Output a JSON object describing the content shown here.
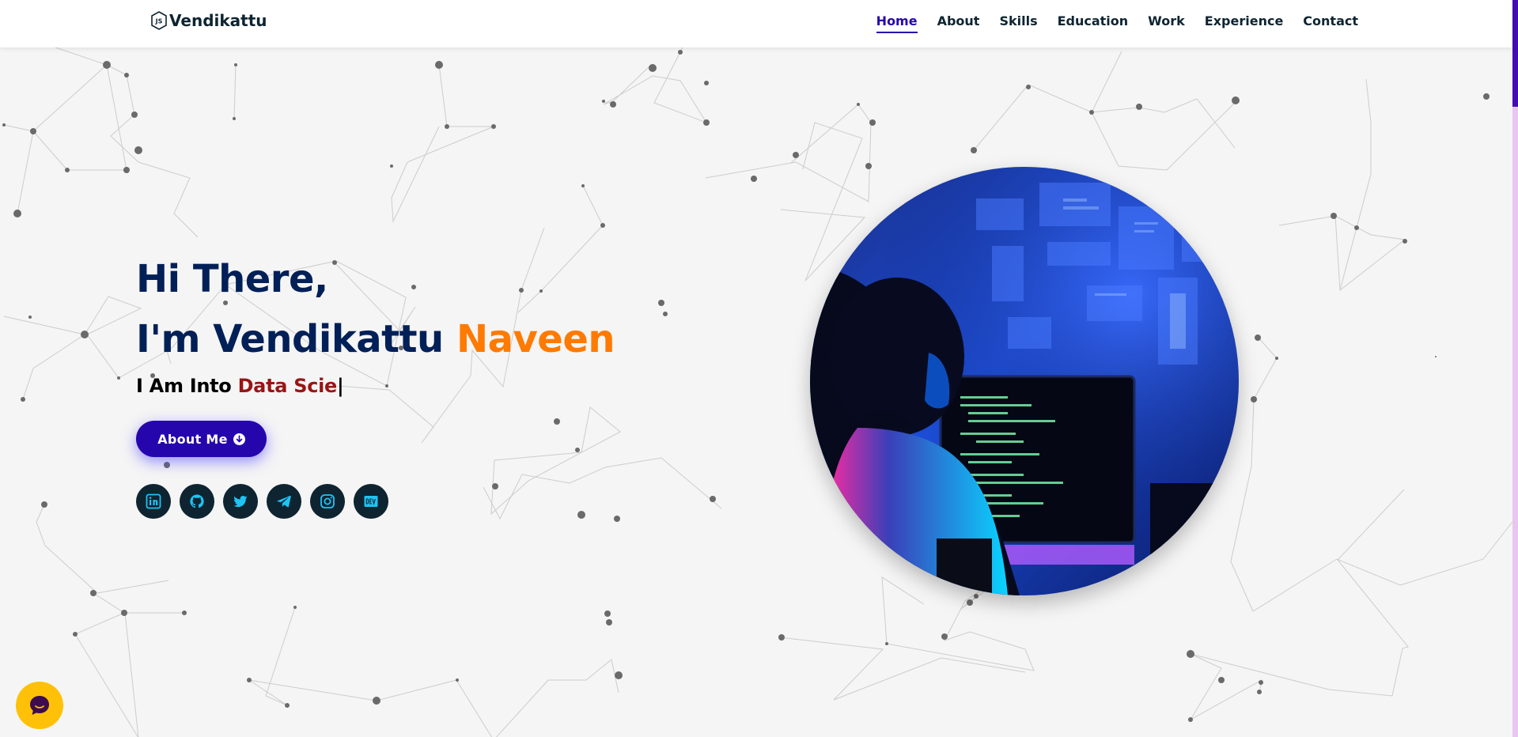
{
  "header": {
    "logo_text": "Vendikattu",
    "logo_icon": "javascript-hex-icon",
    "nav": [
      {
        "label": "Home",
        "active": true
      },
      {
        "label": "About",
        "active": false
      },
      {
        "label": "Skills",
        "active": false
      },
      {
        "label": "Education",
        "active": false
      },
      {
        "label": "Work",
        "active": false
      },
      {
        "label": "Experience",
        "active": false
      },
      {
        "label": "Contact",
        "active": false
      }
    ]
  },
  "hero": {
    "greeting": "Hi There,",
    "intro": "I'm Vendikattu ",
    "name_highlight": "Naveen",
    "typed_prefix": "I Am Into ",
    "typed_text": "Data Scie",
    "typed_cursor": "|",
    "about_button": "About Me",
    "socials": [
      "linkedin-icon",
      "github-icon",
      "twitter-icon",
      "telegram-icon",
      "instagram-icon",
      "dev-icon"
    ]
  },
  "colors": {
    "navy": "#002057",
    "accent_orange": "#ff7a00",
    "typed_red": "#991515",
    "button_purple": "#2506ad",
    "social_bg": "#0e2431",
    "chat_yellow": "#ffc107",
    "scroll_thumb": "#420eb3"
  }
}
